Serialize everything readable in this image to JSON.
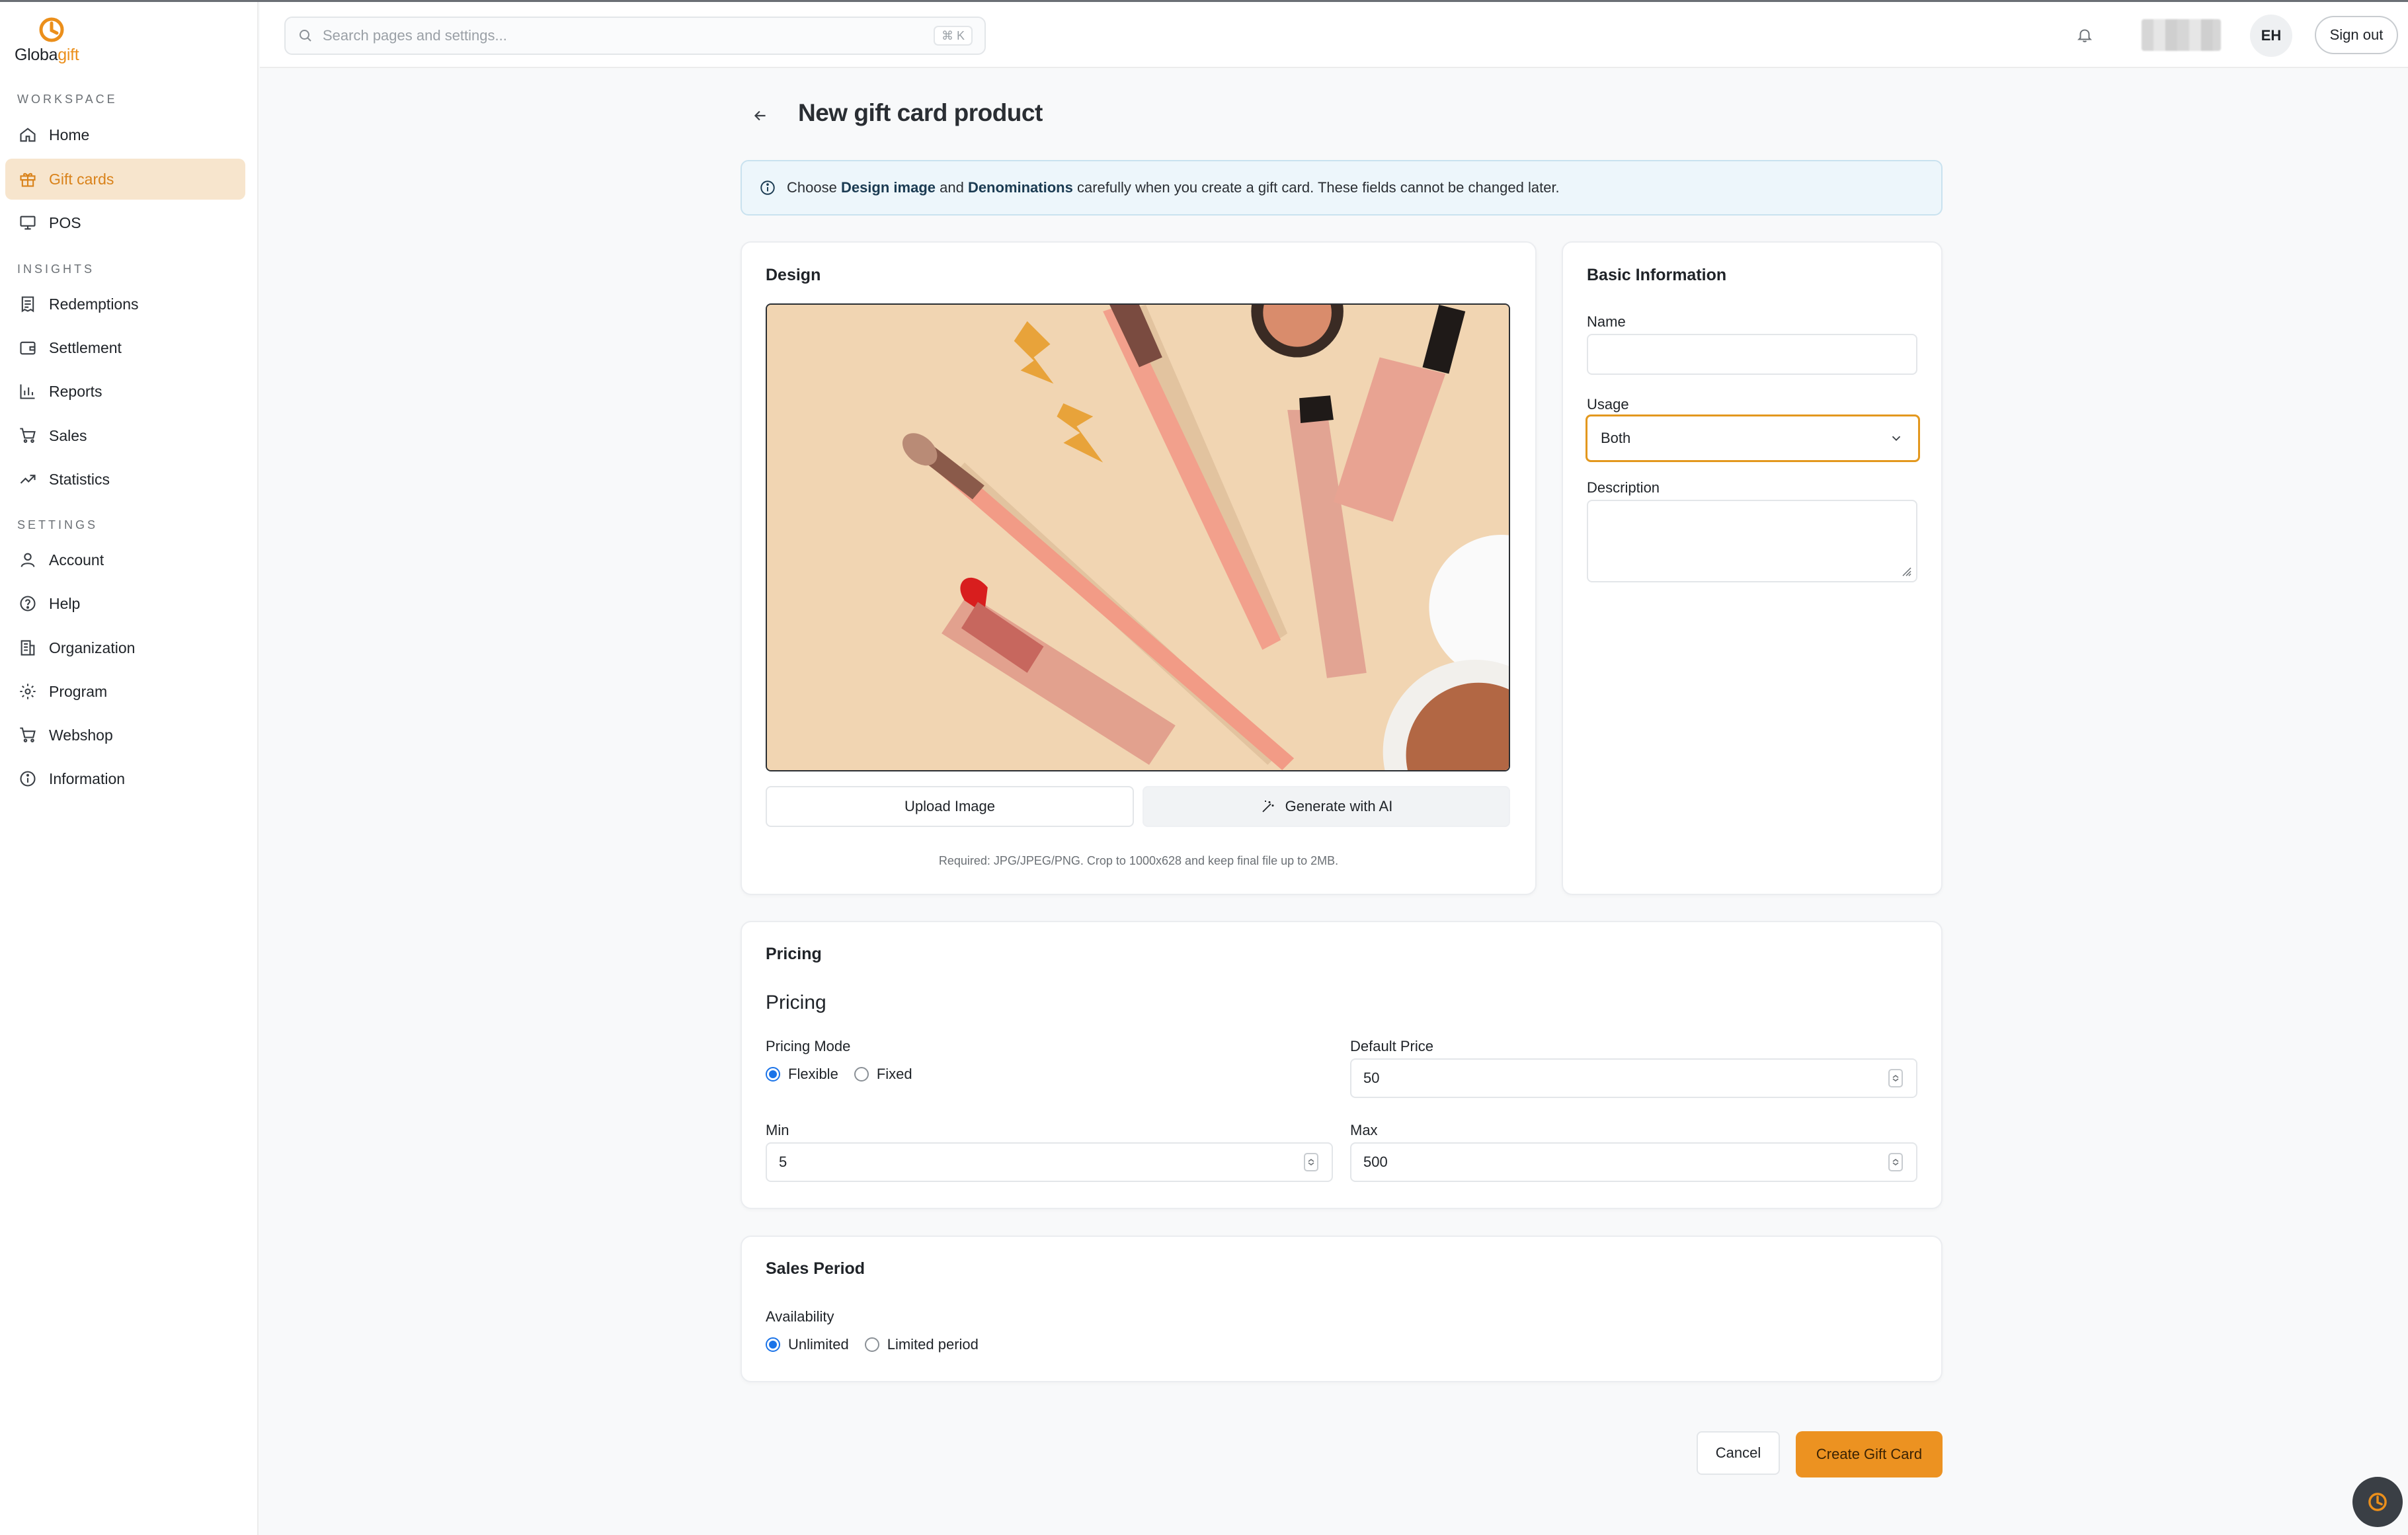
{
  "brand": {
    "name_main": "Globa",
    "name_accent": "gift",
    "accent_color": "#eb8f1b"
  },
  "sidebar": {
    "sections": [
      {
        "label": "WORKSPACE",
        "items": [
          {
            "label": "Home",
            "icon": "home-icon"
          },
          {
            "label": "Gift cards",
            "icon": "gift-icon",
            "active": true
          },
          {
            "label": "POS",
            "icon": "monitor-icon"
          }
        ]
      },
      {
        "label": "INSIGHTS",
        "items": [
          {
            "label": "Redemptions",
            "icon": "receipt-icon"
          },
          {
            "label": "Settlement",
            "icon": "wallet-icon"
          },
          {
            "label": "Reports",
            "icon": "bar-chart-icon"
          },
          {
            "label": "Sales",
            "icon": "cart-icon"
          },
          {
            "label": "Statistics",
            "icon": "trend-icon"
          }
        ]
      },
      {
        "label": "SETTINGS",
        "items": [
          {
            "label": "Account",
            "icon": "user-icon"
          },
          {
            "label": "Help",
            "icon": "help-icon"
          },
          {
            "label": "Organization",
            "icon": "building-icon"
          },
          {
            "label": "Program",
            "icon": "gear-icon"
          },
          {
            "label": "Webshop",
            "icon": "cart-icon"
          },
          {
            "label": "Information",
            "icon": "info-icon"
          }
        ]
      }
    ]
  },
  "topbar": {
    "search_placeholder": "Search pages and settings...",
    "search_shortcut": "⌘ K",
    "avatar_initials": "EH",
    "signout_label": "Sign out"
  },
  "page": {
    "title": "New gift card product"
  },
  "notice": {
    "pre": "Choose ",
    "bold1": "Design image",
    "mid": " and ",
    "bold2": "Denominations",
    "post": " carefully when you create a gift card. These fields cannot be changed later."
  },
  "design": {
    "title": "Design",
    "upload_label": "Upload Image",
    "ai_label": "Generate with AI",
    "hint": "Required: JPG/JPEG/PNG. Crop to 1000x628 and keep final file up to 2MB."
  },
  "basic": {
    "title": "Basic Information",
    "name_label": "Name",
    "name_value": "",
    "usage_label": "Usage",
    "usage_value": "Both",
    "description_label": "Description"
  },
  "pricing": {
    "title": "Pricing",
    "subtitle": "Pricing",
    "mode_label": "Pricing Mode",
    "mode_options": [
      "Flexible",
      "Fixed"
    ],
    "mode_selected": "Flexible",
    "default_price_label": "Default Price",
    "default_price": "50",
    "min_label": "Min",
    "min_value": "5",
    "max_label": "Max",
    "max_value": "500"
  },
  "sales": {
    "title": "Sales Period",
    "availability_label": "Availability",
    "options": [
      "Unlimited",
      "Limited period"
    ],
    "selected": "Unlimited"
  },
  "actions": {
    "cancel_label": "Cancel",
    "create_label": "Create Gift Card",
    "primary_color": "#ec9221"
  }
}
